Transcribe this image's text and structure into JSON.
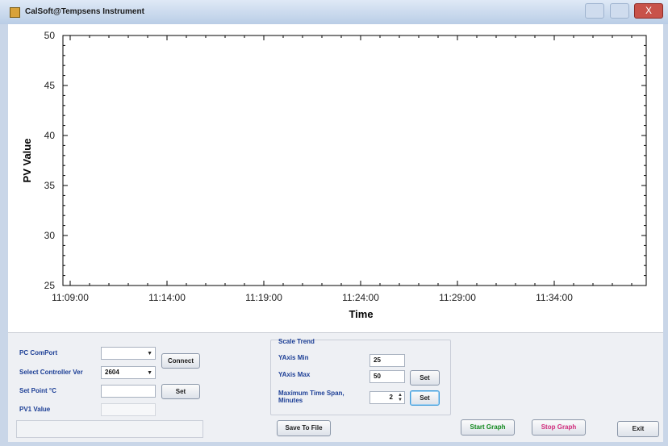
{
  "window": {
    "title": "CalSoft@Tempsens Instrument",
    "close_glyph": "X"
  },
  "chart_data": {
    "type": "line",
    "title": "",
    "xlabel": "Time",
    "ylabel": "PV Value",
    "ylim": [
      25,
      50
    ],
    "yticks": [
      25,
      30,
      35,
      40,
      45,
      50
    ],
    "xticks": [
      "11:09:00",
      "11:14:00",
      "11:19:00",
      "11:24:00",
      "11:29:00",
      "11:34:00"
    ],
    "series": [],
    "grid": false
  },
  "controls": {
    "com_port_label": "PC ComPort",
    "com_port_value": "",
    "connect_label": "Connect",
    "controller_label": "Select Controller Ver",
    "controller_value": "2604",
    "set_point_label": "Set Point °C",
    "set_point_value": "",
    "set_label": "Set",
    "pv1_label": "PV1 Value",
    "pv1_value": ""
  },
  "scale_trend": {
    "title": "Scale Trend",
    "ymin_label": "YAxis Min",
    "ymin_value": "25",
    "ymax_label": "YAxis Max",
    "ymax_value": "50",
    "set_label": "Set",
    "timespan_label": "Maximum Time Span, Minutes",
    "timespan_value": "2",
    "set2_label": "Set"
  },
  "actions": {
    "save_label": "Save To File",
    "start_label": "Start Graph",
    "stop_label": "Stop Graph",
    "exit_label": "Exit"
  }
}
